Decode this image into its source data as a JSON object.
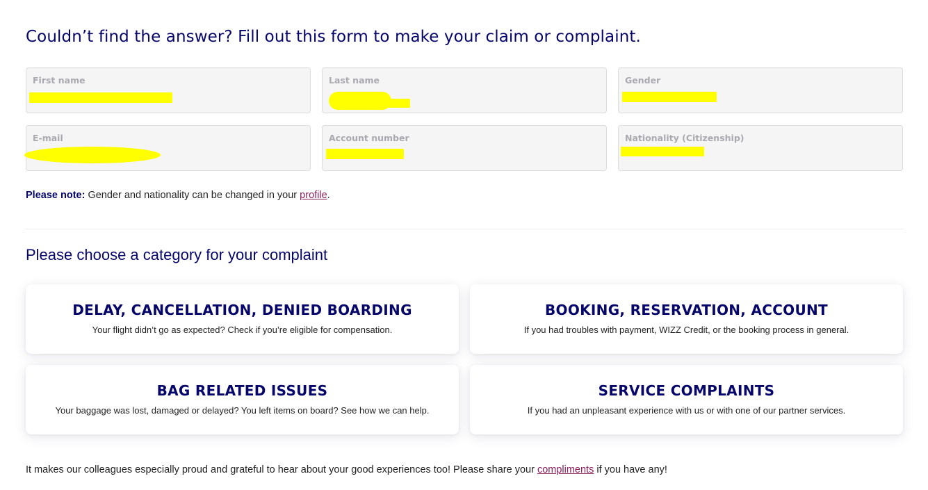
{
  "page_heading": "Couldn’t find the answer? Fill out this form to make your claim or complaint.",
  "fields": {
    "first_name": {
      "label": "First name",
      "value": ""
    },
    "last_name": {
      "label": "Last name",
      "value": ""
    },
    "gender": {
      "label": "Gender",
      "value": ""
    },
    "email": {
      "label": "E-mail",
      "value": ""
    },
    "account_number": {
      "label": "Account number",
      "value": ""
    },
    "nationality": {
      "label": "Nationality (Citizenship)",
      "value": ""
    }
  },
  "note": {
    "bold": "Please note:",
    "text": " Gender and nationality can be changed in your ",
    "link": "profile",
    "end": "."
  },
  "category_heading": "Please choose a category for your complaint",
  "categories": [
    {
      "title": "DELAY, CANCELLATION, DENIED BOARDING",
      "description": "Your flight didn’t go as expected?  Check if you’re eligible for compensation."
    },
    {
      "title": "BOOKING, RESERVATION, ACCOUNT",
      "description": "If you had troubles with payment, WIZZ Credit, or the booking process in general."
    },
    {
      "title": "BAG RELATED ISSUES",
      "description": "Your baggage was lost, damaged or delayed? You left items on board? See how we can help."
    },
    {
      "title": "SERVICE COMPLAINTS",
      "description": "If you had an unpleasant experience with us or with one of our partner services."
    }
  ],
  "footer": {
    "text": "It makes our colleagues especially proud and grateful to hear about your good experiences too! Please share your ",
    "link": "compliments",
    "end": " if you have any!"
  },
  "colors": {
    "heading": "#06066a",
    "link": "#8a1f5e",
    "redaction": "#ffff00"
  }
}
